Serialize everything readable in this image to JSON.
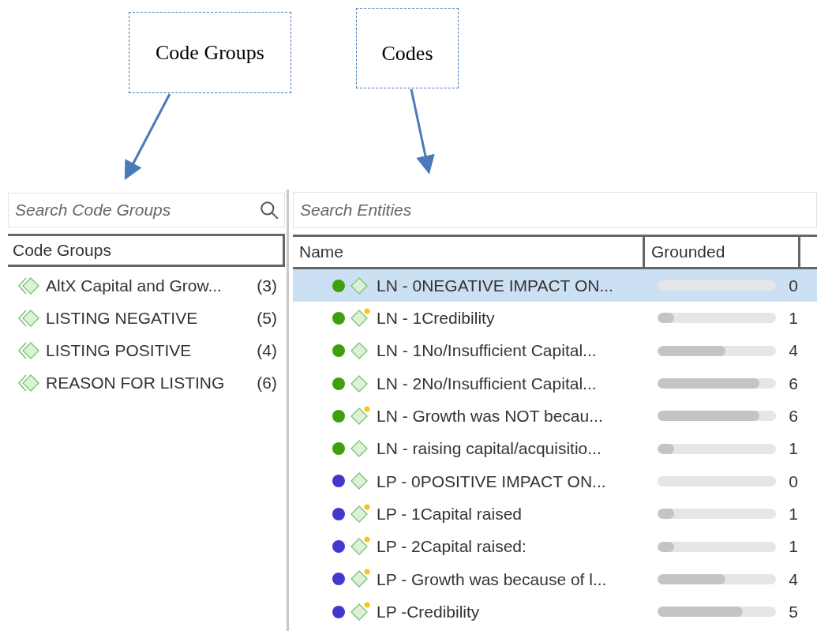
{
  "callouts": [
    {
      "label": "Code Groups"
    },
    {
      "label": "Codes"
    }
  ],
  "code_groups_panel": {
    "search": {
      "placeholder": "Search Code Groups"
    },
    "header": "Code Groups",
    "items": [
      {
        "name": "AltX Capital and Grow...",
        "count": "(3)"
      },
      {
        "name": "LISTING NEGATIVE",
        "count": "(5)"
      },
      {
        "name": "LISTING POSITIVE",
        "count": "(4)"
      },
      {
        "name": "REASON FOR LISTING",
        "count": "(6)"
      }
    ]
  },
  "codes_panel": {
    "search": {
      "placeholder": "Search Entities"
    },
    "columns": [
      "Name",
      "Grounded"
    ],
    "rows": [
      {
        "name": "LN - 0NEGATIVE IMPACT ON...",
        "color": "#3fa00e",
        "memo": false,
        "selected": true,
        "level": 0,
        "grounded": "0"
      },
      {
        "name": "LN - 1Credibility",
        "color": "#3fa00e",
        "memo": true,
        "selected": false,
        "level": 0.14,
        "grounded": "1"
      },
      {
        "name": "LN - 1No/Insufficient Capital...",
        "color": "#3fa00e",
        "memo": false,
        "selected": false,
        "level": 0.57,
        "grounded": "4"
      },
      {
        "name": "LN - 2No/Insufficient Capital...",
        "color": "#3fa00e",
        "memo": false,
        "selected": false,
        "level": 0.86,
        "grounded": "6"
      },
      {
        "name": "LN - Growth was NOT becau...",
        "color": "#3fa00e",
        "memo": true,
        "selected": false,
        "level": 0.86,
        "grounded": "6"
      },
      {
        "name": "LN - raising capital/acquisitio...",
        "color": "#3fa00e",
        "memo": false,
        "selected": false,
        "level": 0.14,
        "grounded": "1"
      },
      {
        "name": "LP - 0POSITIVE IMPACT ON...",
        "color": "#4438cc",
        "memo": false,
        "selected": false,
        "level": 0,
        "grounded": "0"
      },
      {
        "name": "LP - 1Capital raised",
        "color": "#4438cc",
        "memo": true,
        "selected": false,
        "level": 0.14,
        "grounded": "1"
      },
      {
        "name": "LP - 2Capital raised:",
        "color": "#4438cc",
        "memo": true,
        "selected": false,
        "level": 0.14,
        "grounded": "1"
      },
      {
        "name": "LP - Growth was because of l...",
        "color": "#4438cc",
        "memo": true,
        "selected": false,
        "level": 0.57,
        "grounded": "4"
      },
      {
        "name": "LP -Credibility",
        "color": "#4438cc",
        "memo": true,
        "selected": false,
        "level": 0.72,
        "grounded": "5"
      }
    ]
  }
}
